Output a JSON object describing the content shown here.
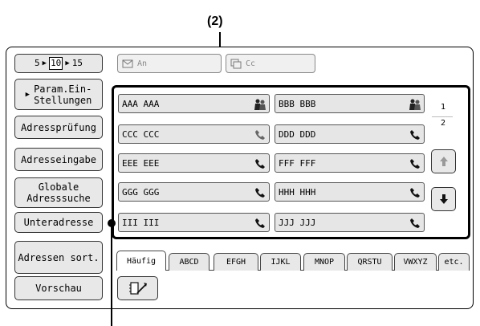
{
  "callouts": {
    "top": "(2)"
  },
  "range_selector": {
    "start": "5",
    "current": "10",
    "end": "15"
  },
  "fields": {
    "to_label": "An",
    "cc_label": "Cc"
  },
  "left_buttons": [
    "Param.Ein-\nStellungen",
    "Adressprüfung",
    "Adresseingabe",
    "Globale\nAdresssuche",
    "Unteradresse",
    "Adressen sort.",
    "Vorschau"
  ],
  "addresses": [
    {
      "name": "AAA AAA",
      "icon": "group-icon"
    },
    {
      "name": "BBB BBB",
      "icon": "group-icon"
    },
    {
      "name": "CCC CCC",
      "icon": "phone-icon"
    },
    {
      "name": "DDD DDD",
      "icon": "phone-icon"
    },
    {
      "name": "EEE EEE",
      "icon": "phone-icon"
    },
    {
      "name": "FFF FFF",
      "icon": "phone-icon"
    },
    {
      "name": "GGG GGG",
      "icon": "phone-icon"
    },
    {
      "name": "HHH HHH",
      "icon": "phone-icon"
    },
    {
      "name": "III III",
      "icon": "phone-icon"
    },
    {
      "name": "JJJ JJJ",
      "icon": "phone-icon"
    }
  ],
  "page": {
    "current": "1",
    "total": "2"
  },
  "tabs": [
    "Häufig",
    "ABCD",
    "EFGH",
    "IJKL",
    "MNOP",
    "QRSTU",
    "VWXYZ",
    "etc."
  ],
  "active_tab": "Häufig"
}
